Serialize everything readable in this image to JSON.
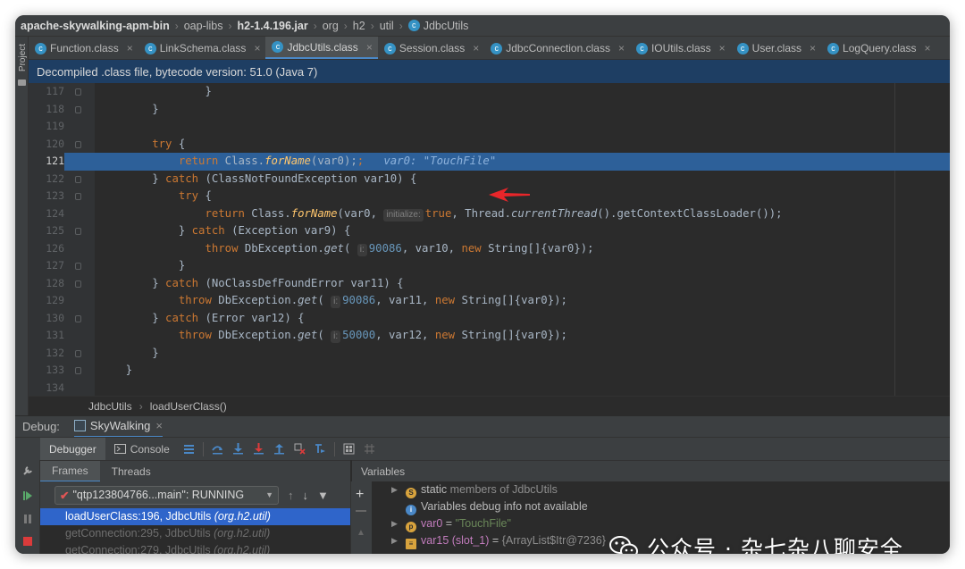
{
  "breadcrumb": [
    {
      "label": "apache-skywalking-apm-bin",
      "bold": true
    },
    {
      "label": "oap-libs",
      "bold": false
    },
    {
      "label": "h2-1.4.196.jar",
      "bold": true
    },
    {
      "label": "org",
      "bold": false
    },
    {
      "label": "h2",
      "bold": false
    },
    {
      "label": "util",
      "bold": false
    },
    {
      "label": "JdbcUtils",
      "bold": false
    }
  ],
  "left_strip": {
    "label": "Project"
  },
  "tabs": [
    {
      "label": "Function.class"
    },
    {
      "label": "LinkSchema.class"
    },
    {
      "label": "JdbcUtils.class",
      "active": true
    },
    {
      "label": "Session.class"
    },
    {
      "label": "JdbcConnection.class"
    },
    {
      "label": "IOUtils.class"
    },
    {
      "label": "User.class"
    },
    {
      "label": "LogQuery.class"
    }
  ],
  "banner": "Decompiled .class file, bytecode version: 51.0 (Java 7)",
  "editor": {
    "current_line": 121,
    "line_numbers": [
      "117",
      "118",
      "119",
      "120",
      "121",
      "122",
      "123",
      "124",
      "125",
      "126",
      "127",
      "128",
      "129",
      "130",
      "131",
      "132",
      "133",
      "134"
    ],
    "code": {
      "l117": "}",
      "l118": "}",
      "l120_try": "try",
      "l120_rest": " {",
      "l121_return": "return",
      "l121_a": " Class.",
      "l121_m": "forName",
      "l121_b": "(var0);",
      "l121_debug": "var0: \"TouchFile\"",
      "l122_a": "} ",
      "l122_catch": "catch",
      "l122_b": " (ClassNotFoundException var10) {",
      "l123_try": "try",
      "l123_b": " {",
      "l124_return": "return",
      "l124_a": " Class.",
      "l124_m": "forName",
      "l124_b": "(var0, ",
      "l124_hint": "initialize:",
      "l124_true": "true",
      "l124_c": ", Thread.",
      "l124_m2": "currentThread",
      "l124_d": "().getContextClassLoader());",
      "l125_a": "} ",
      "l125_catch": "catch",
      "l125_b": " (Exception var9) {",
      "l126_throw": "throw",
      "l126_a": " DbException.",
      "l126_m": "get",
      "l126_b": "( ",
      "l126_hint": "i:",
      "l126_num": "90086",
      "l126_c": ", var10, ",
      "l126_new": "new",
      "l126_d": " String[]{var0});",
      "l127": "}",
      "l128_a": "} ",
      "l128_catch": "catch",
      "l128_b": " (NoClassDefFoundError var11) {",
      "l129_throw": "throw",
      "l129_a": " DbException.",
      "l129_m": "get",
      "l129_b": "( ",
      "l129_hint": "i:",
      "l129_num": "90086",
      "l129_c": ", var11, ",
      "l129_new": "new",
      "l129_d": " String[]{var0});",
      "l130_a": "} ",
      "l130_catch": "catch",
      "l130_b": " (Error var12) {",
      "l131_throw": "throw",
      "l131_a": " DbException.",
      "l131_m": "get",
      "l131_b": "( ",
      "l131_hint": "i:",
      "l131_num": "50000",
      "l131_c": ", var12, ",
      "l131_new": "new",
      "l131_d": " String[]{var0});",
      "l132": "}",
      "l133": "}"
    }
  },
  "code_breadcrumb": {
    "class": "JdbcUtils",
    "method": "loadUserClass()"
  },
  "debug": {
    "label": "Debug:",
    "config_name": "SkyWalking",
    "toolbar_tabs": {
      "debugger": "Debugger",
      "console": "Console"
    },
    "subtabs": {
      "frames": "Frames",
      "threads": "Threads"
    },
    "variables_header": "Variables",
    "thread": "\"qtp123804766...main\": RUNNING",
    "frames": [
      {
        "method": "loadUserClass:196, JdbcUtils",
        "pkg": "(org.h2.util)",
        "selected": true
      },
      {
        "method": "getConnection:295, JdbcUtils",
        "pkg": "(org.h2.util)",
        "selected": false
      },
      {
        "method": "getConnection:279, JdbcUtils",
        "pkg": "(org.h2.util)",
        "selected": false
      }
    ],
    "variables": {
      "static_kw": "static",
      "static_rest": "members of JdbcUtils",
      "info": "Variables debug info not available",
      "var0_name": "var0",
      "var0_eq": " = ",
      "var0_value": "\"TouchFile\"",
      "var15_name": "var15 (slot_1)",
      "var15_eq": " = ",
      "var15_value": "{ArrayList$Itr@7236}"
    }
  },
  "watermark": "公众号 · 杂七杂八聊安全",
  "colors": {
    "accent": "#4a88c7",
    "keyword": "#cc7832",
    "number": "#6897bb",
    "string": "#6a8759",
    "highlight": "#2d6099",
    "arrow": "#e8262a"
  }
}
